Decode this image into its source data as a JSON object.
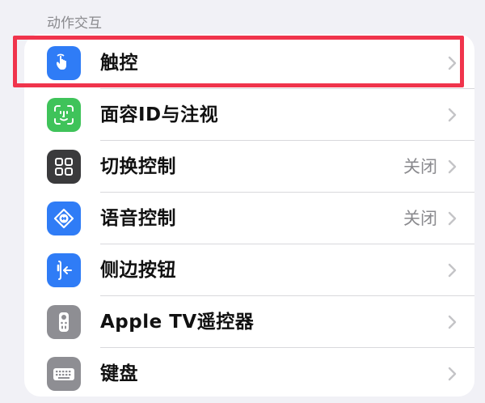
{
  "section": {
    "title": "动作交互"
  },
  "items": [
    {
      "label": "触控",
      "value": "",
      "icon": "hand-tap-icon",
      "icon_bg": "#2f7cf6"
    },
    {
      "label": "面容ID与注视",
      "value": "",
      "icon": "face-id-icon",
      "icon_bg": "#3fc35a"
    },
    {
      "label": "切换控制",
      "value": "关闭",
      "icon": "switch-control-icon",
      "icon_bg": "#3a3a3c"
    },
    {
      "label": "语音控制",
      "value": "关闭",
      "icon": "voice-control-icon",
      "icon_bg": "#2f7cf6"
    },
    {
      "label": "侧边按钮",
      "value": "",
      "icon": "side-button-icon",
      "icon_bg": "#2f7cf6"
    },
    {
      "label": "Apple TV遥控器",
      "value": "",
      "icon": "tv-remote-icon",
      "icon_bg": "#8e8e93"
    },
    {
      "label": "键盘",
      "value": "",
      "icon": "keyboard-icon",
      "icon_bg": "#8e8e93"
    }
  ],
  "highlight_color": "#f0344c"
}
